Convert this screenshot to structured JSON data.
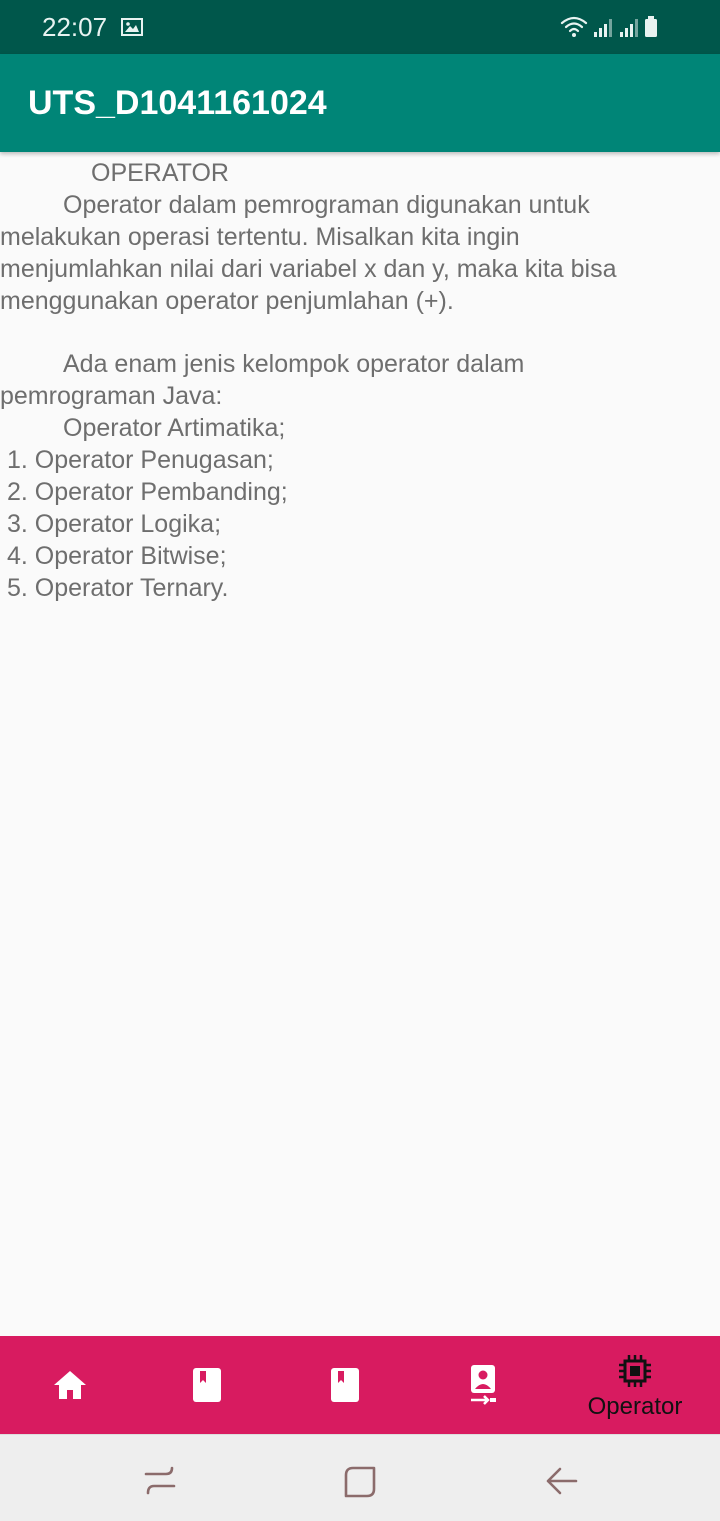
{
  "status_bar": {
    "time": "22:07"
  },
  "app_bar": {
    "title": "UTS_D1041161024"
  },
  "content": {
    "lines": [
      "OPERATOR",
      "Operator dalam pemrograman digunakan untuk",
      "melakukan operasi tertentu.  Misalkan kita ingin",
      "menjumlahkan nilai dari variabel x dan y, maka kita bisa",
      "menggunakan operator penjumlahan (+).",
      "Ada enam jenis kelompok operator dalam",
      "pemrograman Java:",
      "Operator Artimatika;",
      "1. Operator Penugasan;",
      "2. Operator Pembanding;",
      "3. Operator Logika;",
      "4. Operator Bitwise;",
      "5. Operator Ternary."
    ]
  },
  "bottom_nav": {
    "items": [
      {
        "icon": "home-icon"
      },
      {
        "icon": "book-icon"
      },
      {
        "icon": "book-icon"
      },
      {
        "icon": "contact-transfer-icon"
      },
      {
        "icon": "chip-icon",
        "label": "Operator",
        "selected": true
      }
    ],
    "colors": {
      "background": "#d81b60",
      "icon": "#ffffff",
      "selected": "#111111"
    }
  },
  "colors": {
    "primary_dark": "#00574b",
    "primary": "#008577",
    "accent": "#d81b60"
  }
}
